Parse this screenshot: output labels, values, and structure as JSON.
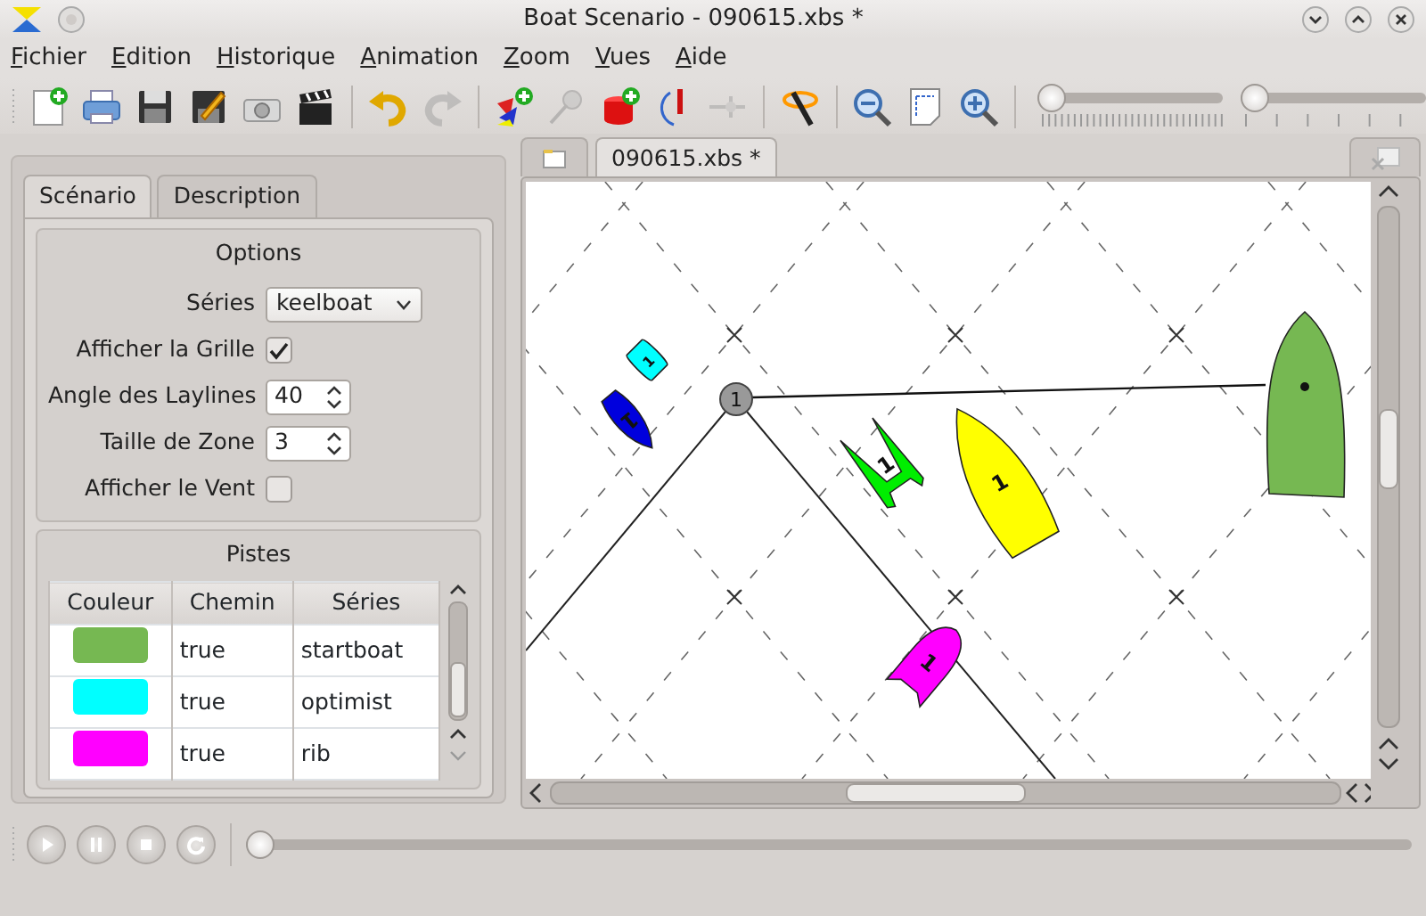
{
  "window": {
    "title": "Boat Scenario - 090615.xbs *"
  },
  "menu": [
    "Fichier",
    "Edition",
    "Historique",
    "Animation",
    "Zoom",
    "Vues",
    "Aide"
  ],
  "toolbar": [
    {
      "disabled": false
    },
    {
      "disabled": false
    },
    {
      "disabled": false
    },
    {
      "disabled": false
    },
    {
      "disabled": false
    },
    {
      "disabled": false
    },
    {
      "disabled": false
    },
    {
      "disabled": true
    },
    {
      "disabled": false
    },
    {
      "disabled": true
    },
    {
      "disabled": false
    },
    {
      "disabled": false
    },
    {
      "disabled": true
    },
    {
      "disabled": false
    },
    {
      "disabled": false
    },
    {
      "disabled": false
    },
    {
      "disabled": false
    }
  ],
  "toolbar_sliders": [
    {
      "level": 0
    },
    {
      "level": 0
    }
  ],
  "side_tabs": [
    {
      "label": "Scénario",
      "selected": true
    },
    {
      "label": "Description",
      "selected": false
    }
  ],
  "options": {
    "title": "Options",
    "series": {
      "label": "Séries",
      "value": "keelboat"
    },
    "grid": {
      "label": "Afficher la Grille",
      "checked": true
    },
    "laylines": {
      "label": "Angle des Laylines",
      "value": "40"
    },
    "zone": {
      "label": "Taille de Zone",
      "value": "3"
    },
    "wind": {
      "label": "Afficher le Vent",
      "checked": false
    }
  },
  "tracks": {
    "title": "Pistes",
    "columns": [
      "Couleur",
      "Chemin",
      "Séries"
    ],
    "rows": [
      {
        "color": "#76b852",
        "path": "true",
        "series": "startboat"
      },
      {
        "color": "#00ffff",
        "path": "true",
        "series": "optimist"
      },
      {
        "color": "#ff00ff",
        "path": "true",
        "series": "rib"
      }
    ]
  },
  "document_tabs": [
    {
      "label": "090615.xbs *",
      "selected": true
    }
  ],
  "canvas": {
    "mark": {
      "label": "1"
    },
    "boats": [
      {
        "kind": "optimist",
        "color": "#00ffff",
        "label": "1"
      },
      {
        "kind": "dinghy",
        "color": "#0000dd",
        "label": "1"
      },
      {
        "kind": "catamaran",
        "color": "#00ee00",
        "label": "1"
      },
      {
        "kind": "keelboat",
        "color": "#ffff00",
        "label": "1"
      },
      {
        "kind": "rib",
        "color": "#ff00ff",
        "label": "1"
      },
      {
        "kind": "startboat",
        "color": "#76b852"
      }
    ]
  },
  "timeline": {
    "level": 0
  }
}
